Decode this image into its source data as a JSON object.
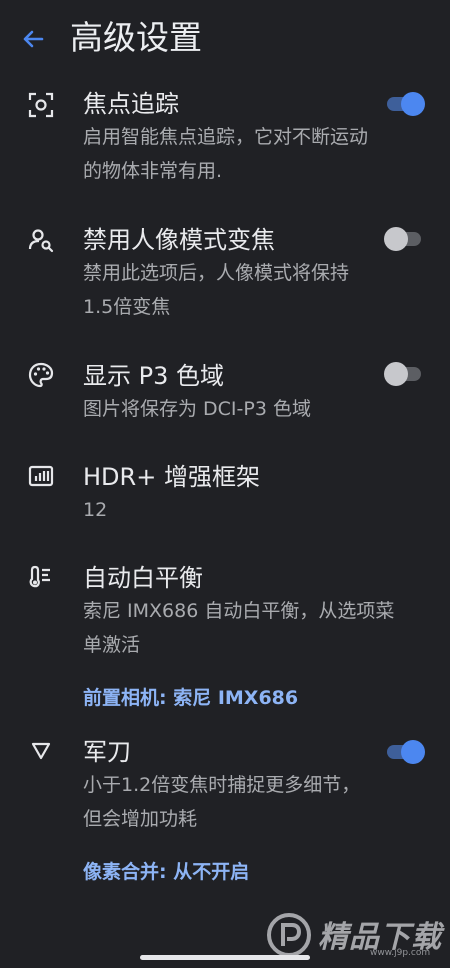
{
  "header": {
    "title": "高级设置",
    "back_icon": "arrow-left-icon"
  },
  "colors": {
    "background": "#202125",
    "accent": "#4c87f0",
    "link": "#8db4f5"
  },
  "settings": [
    {
      "icon": "focus-tracking-icon",
      "label": "焦点追踪",
      "sub": "启用智能焦点追踪，它对不断运动的物体非常有用.",
      "toggle": "on"
    },
    {
      "icon": "person-search-icon",
      "label": "禁用人像模式变焦",
      "sub": "禁用此选项后，人像模式将保持1.5倍变焦",
      "toggle": "off"
    },
    {
      "icon": "palette-icon",
      "label": "显示 P3 色域",
      "sub": "图片将保存为 DCI-P3 色域",
      "toggle": "off"
    },
    {
      "icon": "hdr-frames-icon",
      "label": "HDR+ 增强框架",
      "sub": "12"
    },
    {
      "icon": "thermometer-icon",
      "label": "自动白平衡",
      "sub": "索尼 IMX686 自动白平衡，从选项菜单激活"
    },
    {
      "icon": "triangle-down-icon",
      "label": "军刀",
      "sub": "小于1.2倍变焦时捕捉更多细节，但会增加功耗",
      "toggle": "on"
    }
  ],
  "links": {
    "front_camera": "前置相机: 索尼 IMX686",
    "pixel_binning": "像素合并: 从不开启"
  },
  "watermark": {
    "brand": "精品下载",
    "url": "www.j9p.com"
  }
}
